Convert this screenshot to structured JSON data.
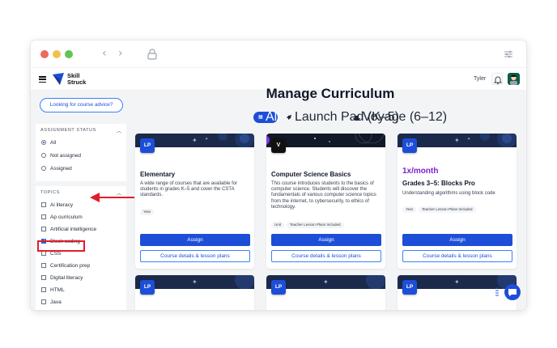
{
  "colors": {
    "accent": "#1d4ed8",
    "highlight": "#e11d2a",
    "banner": "#1b2a4a",
    "price": "#7e22ce"
  },
  "window": {
    "traffic_lights": [
      "#ec6a5e",
      "#f4bf4f",
      "#61c554"
    ],
    "back_icon": "chevron-left-icon",
    "forward_icon": "chevron-right-icon",
    "lock_icon": "lock-icon"
  },
  "header": {
    "brand_line1": "Skill",
    "brand_line2": "Struck",
    "user_name": "Tyler"
  },
  "page": {
    "title": "Manage Curriculum"
  },
  "sidebar": {
    "advice_button": "Looking for course advice?",
    "assignment_status": {
      "title": "ASSIGNMENT STATUS",
      "options": [
        {
          "label": "All",
          "selected": true
        },
        {
          "label": "Not assigned",
          "selected": false
        },
        {
          "label": "Assigned",
          "selected": false
        }
      ]
    },
    "topics": {
      "title": "TOPICS",
      "items": [
        {
          "label": "Ai literacy",
          "checked": false
        },
        {
          "label": "Ap curriculum",
          "checked": false
        },
        {
          "label": "Artificial intelligence",
          "checked": false
        },
        {
          "label": "Block coding",
          "checked": true
        },
        {
          "label": "CSS",
          "checked": false
        },
        {
          "label": "Certification prep",
          "checked": false
        },
        {
          "label": "Digital literacy",
          "checked": false
        },
        {
          "label": "HTML",
          "checked": false
        },
        {
          "label": "Java",
          "checked": false
        }
      ]
    }
  },
  "tabs": [
    {
      "label": "All",
      "active": true
    },
    {
      "label": "Launch Pad (K–5)",
      "active": false
    },
    {
      "label": "Voyage (6–12)",
      "active": false
    }
  ],
  "cards": [
    {
      "chip": "LP",
      "title": "Elementary",
      "description": "A wide range of courses that are available for students in grades K–5 and cover the CSTA standards.",
      "tags": [
        "Year"
      ],
      "assign": "Assign",
      "details": "Course details & lesson plans"
    },
    {
      "chip": "V",
      "title": "Computer Science Basics",
      "description": "This course introduces students to the basics of computer science. Students will discover the fundamentals of various computer science topics from the internet, to cybersecurity, to ethics of technology.",
      "tags": [
        "Unit",
        "Teacher Lesson Plans Included"
      ],
      "assign": "Assign",
      "details": "Course details & lesson plans"
    },
    {
      "chip": "LP",
      "price": "1x/month",
      "title": "Grades 3–5: Blocks Pro",
      "description": "Understanding algorithms using block code",
      "tags": [
        "Year",
        "Teacher Lesson Plans Included"
      ],
      "assign": "Assign",
      "details": "Course details & lesson plans"
    }
  ],
  "second_row_chips": [
    "LP",
    "LP",
    "LP"
  ]
}
